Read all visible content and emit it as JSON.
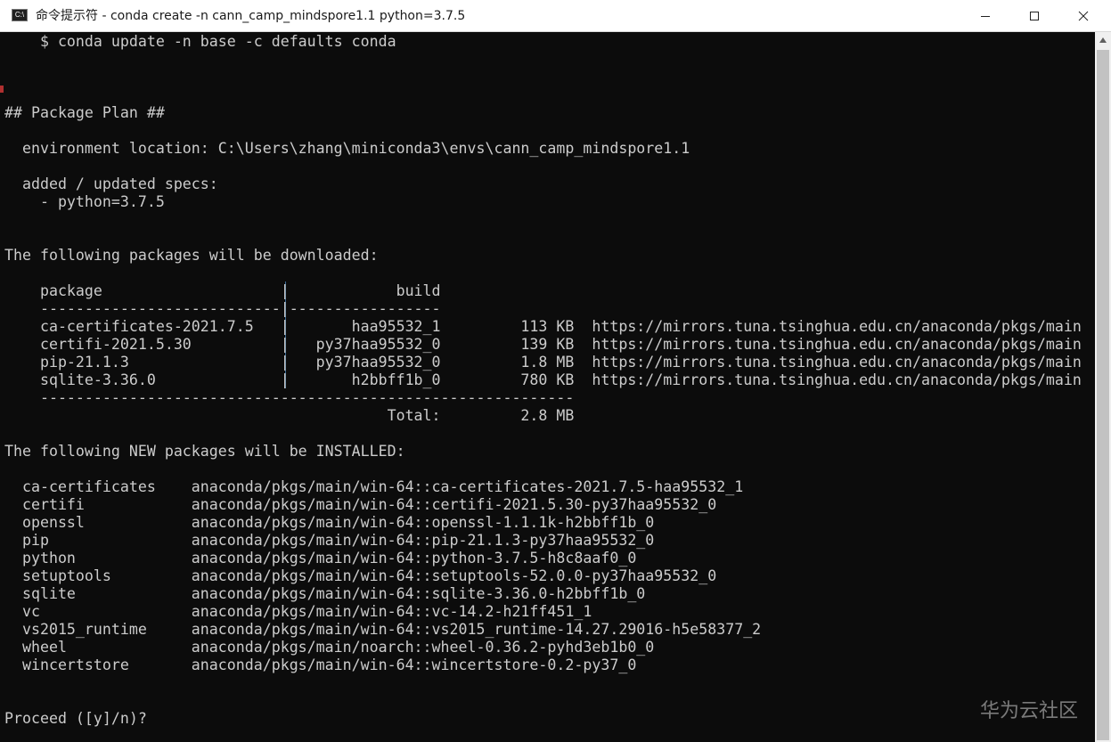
{
  "window": {
    "title": "命令提示符 - conda  create -n cann_camp_mindspore1.1 python=3.7.5",
    "icon_label": "C:\\"
  },
  "console_lines": [
    "    $ conda update -n base -c defaults conda",
    "",
    "",
    "",
    "## Package Plan ##",
    "",
    "  environment location: C:\\Users\\zhang\\miniconda3\\envs\\cann_camp_mindspore1.1",
    "",
    "  added / updated specs:",
    "    - python=3.7.5",
    "",
    "",
    "The following packages will be downloaded:",
    "",
    "    package                    |            build",
    "    ---------------------------|-----------------",
    "    ca-certificates-2021.7.5   |       haa95532_1         113 KB  https://mirrors.tuna.tsinghua.edu.cn/anaconda/pkgs/main",
    "    certifi-2021.5.30          |   py37haa95532_0         139 KB  https://mirrors.tuna.tsinghua.edu.cn/anaconda/pkgs/main",
    "    pip-21.1.3                 |   py37haa95532_0         1.8 MB  https://mirrors.tuna.tsinghua.edu.cn/anaconda/pkgs/main",
    "    sqlite-3.36.0              |       h2bbff1b_0         780 KB  https://mirrors.tuna.tsinghua.edu.cn/anaconda/pkgs/main",
    "    ------------------------------------------------------------",
    "                                           Total:         2.8 MB",
    "",
    "The following NEW packages will be INSTALLED:",
    "",
    "  ca-certificates    anaconda/pkgs/main/win-64::ca-certificates-2021.7.5-haa95532_1",
    "  certifi            anaconda/pkgs/main/win-64::certifi-2021.5.30-py37haa95532_0",
    "  openssl            anaconda/pkgs/main/win-64::openssl-1.1.1k-h2bbff1b_0",
    "  pip                anaconda/pkgs/main/win-64::pip-21.1.3-py37haa95532_0",
    "  python             anaconda/pkgs/main/win-64::python-3.7.5-h8c8aaf0_0",
    "  setuptools         anaconda/pkgs/main/win-64::setuptools-52.0.0-py37haa95532_0",
    "  sqlite             anaconda/pkgs/main/win-64::sqlite-3.36.0-h2bbff1b_0",
    "  vc                 anaconda/pkgs/main/win-64::vc-14.2-h21ff451_1",
    "  vs2015_runtime     anaconda/pkgs/main/win-64::vs2015_runtime-14.27.29016-h5e58377_2",
    "  wheel              anaconda/pkgs/main/noarch::wheel-0.36.2-pyhd3eb1b0_0",
    "  wincertstore       anaconda/pkgs/main/win-64::wincertstore-0.2-py37_0",
    "",
    "",
    "Proceed ([y]/n)?"
  ],
  "watermark": "华为云社区",
  "colors": {
    "background": "#0c0c0c",
    "text": "#cccccc",
    "titlebar": "#ffffff"
  }
}
